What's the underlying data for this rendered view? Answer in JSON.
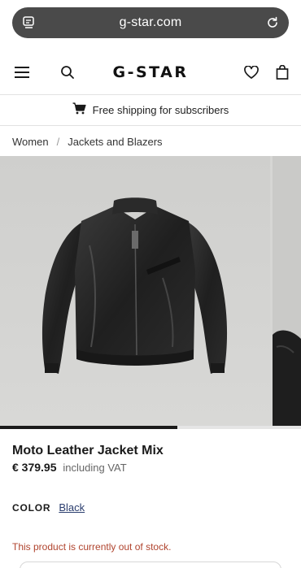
{
  "browser": {
    "url": "g-star.com",
    "left_icon": "tabs-icon",
    "right_icon": "reload-icon"
  },
  "header": {
    "logo": "G-STAR",
    "icons": [
      "menu-icon",
      "search-icon",
      "wishlist-heart-icon",
      "shopping-bag-icon"
    ]
  },
  "banner": {
    "text": "Free shipping for subscribers",
    "icon": "cart-icon"
  },
  "breadcrumb": {
    "items": [
      "Women",
      "Jackets and Blazers"
    ],
    "separator": "/"
  },
  "gallery": {
    "slide_count_visible": 2,
    "progress_fraction": 0.59
  },
  "product": {
    "name": "Moto Leather Jacket Mix",
    "price": "€ 379.95",
    "vat_note": "including VAT",
    "color_label": "COLOR",
    "color_value": "Black",
    "stock_message": "This product is currently out of stock."
  },
  "colors": {
    "accent_link": "#2a3d6e",
    "error": "#b0442e",
    "url_bar": "#4a4a4a"
  }
}
